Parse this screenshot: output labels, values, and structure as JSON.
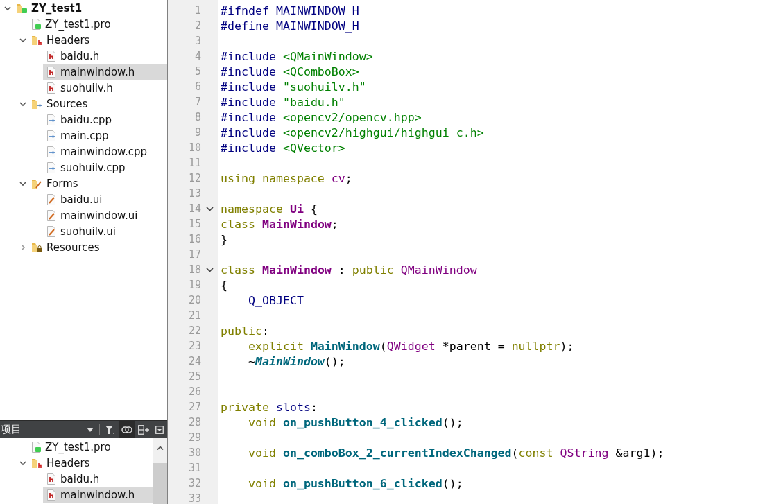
{
  "project_tree": {
    "items": [
      {
        "label": "ZY_test1",
        "kind": "project",
        "expanded": true,
        "selected": false,
        "children": [
          {
            "label": "ZY_test1.pro",
            "kind": "pro",
            "selected": false
          },
          {
            "label": "Headers",
            "kind": "header-folder",
            "expanded": true,
            "selected": false,
            "children": [
              {
                "label": "baidu.h",
                "kind": "header",
                "selected": false
              },
              {
                "label": "mainwindow.h",
                "kind": "header",
                "selected": true
              },
              {
                "label": "suohuilv.h",
                "kind": "header",
                "selected": false
              }
            ]
          },
          {
            "label": "Sources",
            "kind": "source-folder",
            "expanded": true,
            "selected": false,
            "children": [
              {
                "label": "baidu.cpp",
                "kind": "source",
                "selected": false
              },
              {
                "label": "main.cpp",
                "kind": "source",
                "selected": false
              },
              {
                "label": "mainwindow.cpp",
                "kind": "source",
                "selected": false
              },
              {
                "label": "suohuilv.cpp",
                "kind": "source",
                "selected": false
              }
            ]
          },
          {
            "label": "Forms",
            "kind": "form-folder",
            "expanded": true,
            "selected": false,
            "children": [
              {
                "label": "baidu.ui",
                "kind": "form",
                "selected": false
              },
              {
                "label": "mainwindow.ui",
                "kind": "form",
                "selected": false
              },
              {
                "label": "suohuilv.ui",
                "kind": "form",
                "selected": false
              }
            ]
          },
          {
            "label": "Resources",
            "kind": "resource-folder",
            "expanded": false,
            "selected": false
          }
        ]
      }
    ]
  },
  "projects_panel": {
    "title": "项目",
    "toolbar": [
      {
        "kind": "dropdown",
        "selected": false
      },
      {
        "kind": "filter",
        "selected": false
      },
      {
        "kind": "link",
        "selected": true
      },
      {
        "kind": "split",
        "selected": false
      },
      {
        "kind": "close",
        "selected": false
      }
    ],
    "items": [
      {
        "label": "ZY_test1.pro",
        "kind": "pro",
        "selected": false
      },
      {
        "label": "Headers",
        "kind": "header-folder",
        "expanded": true,
        "selected": false,
        "children": [
          {
            "label": "baidu.h",
            "kind": "header",
            "selected": false
          },
          {
            "label": "mainwindow.h",
            "kind": "header",
            "selected": true
          }
        ]
      }
    ]
  },
  "editor": {
    "lines": [
      {
        "number": "1",
        "foldable": false,
        "tokens": [
          {
            "text": "#ifndef MAINWINDOW_H",
            "kind": "preproc"
          }
        ]
      },
      {
        "number": "2",
        "foldable": false,
        "tokens": [
          {
            "text": "#define MAINWINDOW_H",
            "kind": "preproc"
          }
        ]
      },
      {
        "number": "3",
        "foldable": false
      },
      {
        "number": "4",
        "foldable": false,
        "tokens": [
          {
            "text": "#include ",
            "kind": "preproc"
          },
          {
            "text": "<QMainWindow>",
            "kind": "string"
          }
        ]
      },
      {
        "number": "5",
        "foldable": false,
        "tokens": [
          {
            "text": "#include ",
            "kind": "preproc"
          },
          {
            "text": "<QComboBox>",
            "kind": "string"
          }
        ]
      },
      {
        "number": "6",
        "foldable": false,
        "tokens": [
          {
            "text": "#include ",
            "kind": "preproc"
          },
          {
            "text": "\"suohuilv.h\"",
            "kind": "string"
          }
        ]
      },
      {
        "number": "7",
        "foldable": false,
        "tokens": [
          {
            "text": "#include ",
            "kind": "preproc"
          },
          {
            "text": "\"baidu.h\"",
            "kind": "string"
          }
        ]
      },
      {
        "number": "8",
        "foldable": false,
        "tokens": [
          {
            "text": "#include ",
            "kind": "preproc"
          },
          {
            "text": "<opencv2/opencv.hpp>",
            "kind": "string"
          }
        ]
      },
      {
        "number": "9",
        "foldable": false,
        "tokens": [
          {
            "text": "#include ",
            "kind": "preproc"
          },
          {
            "text": "<opencv2/highgui/highgui_c.h>",
            "kind": "string"
          }
        ]
      },
      {
        "number": "10",
        "foldable": false,
        "tokens": [
          {
            "text": "#include ",
            "kind": "preproc"
          },
          {
            "text": "<QVector>",
            "kind": "string"
          }
        ]
      },
      {
        "number": "11",
        "foldable": false
      },
      {
        "number": "12",
        "foldable": false,
        "tokens": [
          {
            "text": "using namespace ",
            "kind": "keyword"
          },
          {
            "text": "cv",
            "kind": "type"
          },
          {
            "text": ";",
            "kind": "plain"
          }
        ]
      },
      {
        "number": "13",
        "foldable": false
      },
      {
        "number": "14",
        "foldable": true,
        "tokens": [
          {
            "text": "namespace ",
            "kind": "keyword"
          },
          {
            "text": "Ui",
            "kind": "class"
          },
          {
            "text": " {",
            "kind": "plain"
          }
        ]
      },
      {
        "number": "15",
        "foldable": false,
        "tokens": [
          {
            "text": "class ",
            "kind": "keyword"
          },
          {
            "text": "MainWindow",
            "kind": "class"
          },
          {
            "text": ";",
            "kind": "plain"
          }
        ]
      },
      {
        "number": "16",
        "foldable": false,
        "tokens": [
          {
            "text": "}",
            "kind": "plain"
          }
        ]
      },
      {
        "number": "17",
        "foldable": false
      },
      {
        "number": "18",
        "foldable": true,
        "tokens": [
          {
            "text": "class ",
            "kind": "keyword"
          },
          {
            "text": "MainWindow",
            "kind": "class"
          },
          {
            "text": " : ",
            "kind": "plain"
          },
          {
            "text": "public ",
            "kind": "keyword"
          },
          {
            "text": "QMainWindow",
            "kind": "type"
          }
        ]
      },
      {
        "number": "19",
        "foldable": false,
        "tokens": [
          {
            "text": "{",
            "kind": "plain"
          }
        ]
      },
      {
        "number": "20",
        "foldable": false,
        "tokens": [
          {
            "text": "    Q_OBJECT",
            "kind": "preproc"
          }
        ]
      },
      {
        "number": "21",
        "foldable": false
      },
      {
        "number": "22",
        "foldable": false,
        "tokens": [
          {
            "text": "public",
            "kind": "keyword"
          },
          {
            "text": ":",
            "kind": "plain"
          }
        ]
      },
      {
        "number": "23",
        "foldable": false,
        "tokens": [
          {
            "text": "    explicit ",
            "kind": "keyword"
          },
          {
            "text": "MainWindow",
            "kind": "function"
          },
          {
            "text": "(",
            "kind": "plain"
          },
          {
            "text": "QWidget",
            "kind": "type"
          },
          {
            "text": " *parent = ",
            "kind": "plain"
          },
          {
            "text": "nullptr",
            "kind": "keyword"
          },
          {
            "text": ");",
            "kind": "plain"
          }
        ]
      },
      {
        "number": "24",
        "foldable": false,
        "tokens": [
          {
            "text": "    ~",
            "kind": "plain"
          },
          {
            "text": "MainWindow",
            "kind": "virtual"
          },
          {
            "text": "();",
            "kind": "plain"
          }
        ]
      },
      {
        "number": "25",
        "foldable": false
      },
      {
        "number": "26",
        "foldable": false
      },
      {
        "number": "27",
        "foldable": false,
        "tokens": [
          {
            "text": "private ",
            "kind": "keyword"
          },
          {
            "text": "slots",
            "kind": "preproc"
          },
          {
            "text": ":",
            "kind": "plain"
          }
        ]
      },
      {
        "number": "28",
        "foldable": false,
        "tokens": [
          {
            "text": "    void ",
            "kind": "keyword"
          },
          {
            "text": "on_pushButton_4_clicked",
            "kind": "function"
          },
          {
            "text": "();",
            "kind": "plain"
          }
        ]
      },
      {
        "number": "29",
        "foldable": false
      },
      {
        "number": "30",
        "foldable": false,
        "tokens": [
          {
            "text": "    void ",
            "kind": "keyword"
          },
          {
            "text": "on_comboBox_2_currentIndexChanged",
            "kind": "function"
          },
          {
            "text": "(",
            "kind": "plain"
          },
          {
            "text": "const ",
            "kind": "keyword"
          },
          {
            "text": "QString",
            "kind": "type"
          },
          {
            "text": " &arg1);",
            "kind": "plain"
          }
        ]
      },
      {
        "number": "31",
        "foldable": false
      },
      {
        "number": "32",
        "foldable": false,
        "tokens": [
          {
            "text": "    void ",
            "kind": "keyword"
          },
          {
            "text": "on_pushButton_6_clicked",
            "kind": "function"
          },
          {
            "text": "();",
            "kind": "plain"
          }
        ]
      },
      {
        "number": "33",
        "foldable": false
      }
    ]
  }
}
